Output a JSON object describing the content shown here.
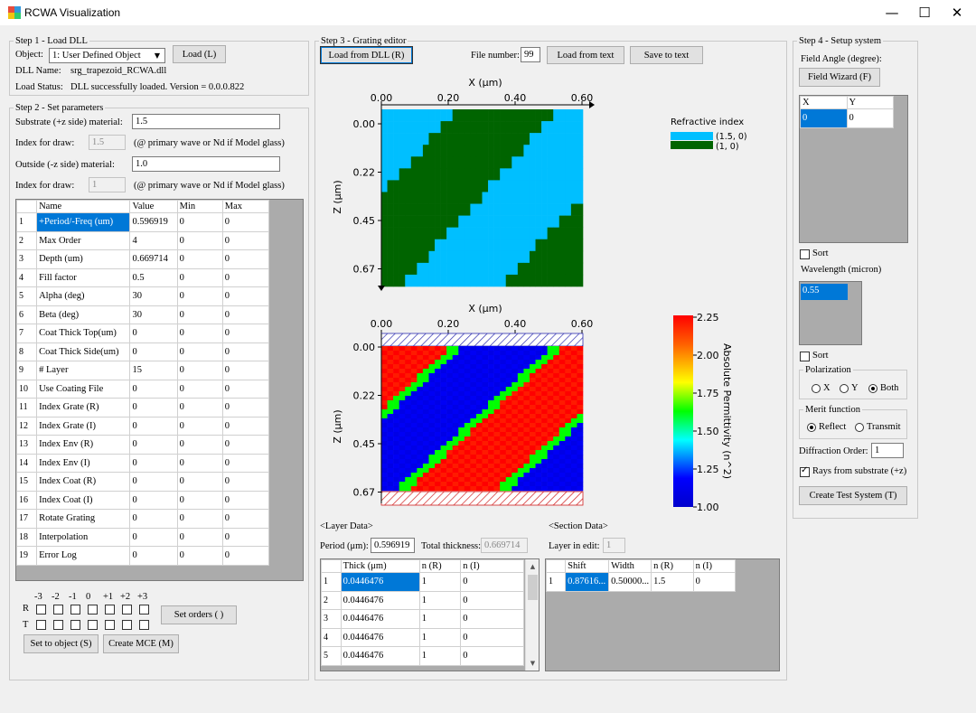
{
  "window": {
    "title": "RCWA Visualization",
    "minimize": "—",
    "maximize": "☐",
    "close": "✕"
  },
  "step1": {
    "legend": "Step 1 - Load DLL",
    "object_label": "Object:",
    "object_value": "1: User Defined Object",
    "load_button": "Load (L)",
    "dll_name_label": "DLL Name:",
    "dll_name_value": "srg_trapezoid_RCWA.dll",
    "load_status_label": "Load Status:",
    "load_status_value": "DLL successfully loaded. Version = 0.0.0.822"
  },
  "step2": {
    "legend": "Step 2 - Set parameters",
    "substrate_label": "Substrate (+z side) material:",
    "substrate_value": "1.5",
    "index_draw_label": "Index for draw:",
    "index_draw1_value": "1.5",
    "index_draw_note": "(@ primary wave or Nd if Model glass)",
    "outside_label": "Outside (-z side) material:",
    "outside_value": "1.0",
    "index_draw2_value": "1",
    "columns": [
      "Name",
      "Value",
      "Min",
      "Max"
    ],
    "rows": [
      [
        "1",
        "+Period/-Freq (um)",
        "0.596919",
        "0",
        "0"
      ],
      [
        "2",
        "Max Order",
        "4",
        "0",
        "0"
      ],
      [
        "3",
        "Depth (um)",
        "0.669714",
        "0",
        "0"
      ],
      [
        "4",
        "Fill factor",
        "0.5",
        "0",
        "0"
      ],
      [
        "5",
        "Alpha (deg)",
        "30",
        "0",
        "0"
      ],
      [
        "6",
        "Beta (deg)",
        "30",
        "0",
        "0"
      ],
      [
        "7",
        "Coat Thick Top(um)",
        "0",
        "0",
        "0"
      ],
      [
        "8",
        "Coat Thick Side(um)",
        "0",
        "0",
        "0"
      ],
      [
        "9",
        "# Layer",
        "15",
        "0",
        "0"
      ],
      [
        "10",
        "Use Coating File",
        "0",
        "0",
        "0"
      ],
      [
        "11",
        "Index Grate (R)",
        "0",
        "0",
        "0"
      ],
      [
        "12",
        "Index Grate (I)",
        "0",
        "0",
        "0"
      ],
      [
        "13",
        "Index Env (R)",
        "0",
        "0",
        "0"
      ],
      [
        "14",
        "Index Env (I)",
        "0",
        "0",
        "0"
      ],
      [
        "15",
        "Index Coat (R)",
        "0",
        "0",
        "0"
      ],
      [
        "16",
        "Index Coat (I)",
        "0",
        "0",
        "0"
      ],
      [
        "17",
        "Rotate Grating",
        "0",
        "0",
        "0"
      ],
      [
        "18",
        "Interpolation",
        "0",
        "0",
        "0"
      ],
      [
        "19",
        "Error Log",
        "0",
        "0",
        "0"
      ]
    ],
    "order_labels": [
      "-3",
      "-2",
      "-1",
      "0",
      "+1",
      "+2",
      "+3"
    ],
    "r_label": "R",
    "t_label": "T",
    "set_orders_button": "Set orders ( )",
    "set_to_object_button": "Set to object (S)",
    "create_mce_button": "Create MCE (M)"
  },
  "step3": {
    "legend": "Step 3 - Grating editor",
    "load_from_dll_button": "Load from DLL (R)",
    "file_number_label": "File number:",
    "file_number_value": "99",
    "load_from_text_button": "Load from text",
    "save_to_text_button": "Save to text",
    "plot1": {
      "xlabel": "X (μm)",
      "ylabel": "Z (μm)",
      "xticks": [
        "0.00",
        "0.20",
        "0.40",
        "0.60"
      ],
      "yticks": [
        "0.00",
        "0.22",
        "0.45",
        "0.67"
      ],
      "legend_title": "Refractive index",
      "legend_entries": [
        {
          "label": "(1.5, 0)",
          "color": "#00bfff"
        },
        {
          "label": "(1, 0)",
          "color": "#006400"
        }
      ]
    },
    "plot2": {
      "xlabel": "X (μm)",
      "ylabel": "Z (μm)",
      "xticks": [
        "0.00",
        "0.20",
        "0.40",
        "0.60"
      ],
      "yticks": [
        "0.00",
        "0.22",
        "0.45",
        "0.67"
      ],
      "colorbar_label": "Absolute Permittivity (n^2)",
      "colorbar_ticks": [
        "2.25",
        "2.00",
        "1.75",
        "1.50",
        "1.25",
        "1.00"
      ]
    },
    "layer_data_label": "<Layer Data>",
    "period_label": "Period (μm):",
    "period_value": "0.596919",
    "total_thickness_label": "Total thickness:",
    "total_thickness_value": "0.669714",
    "layer_columns": [
      "Thick (μm)",
      "n (R)",
      "n (I)"
    ],
    "layer_rows": [
      [
        "1",
        "0.0446476",
        "1",
        "0"
      ],
      [
        "2",
        "0.0446476",
        "1",
        "0"
      ],
      [
        "3",
        "0.0446476",
        "1",
        "0"
      ],
      [
        "4",
        "0.0446476",
        "1",
        "0"
      ],
      [
        "5",
        "0.0446476",
        "1",
        "0"
      ]
    ],
    "section_data_label": "<Section Data>",
    "layer_in_edit_label": "Layer in edit:",
    "layer_in_edit_value": "1",
    "section_columns": [
      "Shift",
      "Width",
      "n (R)",
      "n (I)"
    ],
    "section_rows": [
      [
        "1",
        "0.87616...",
        "0.50000...",
        "1.5",
        "0"
      ]
    ]
  },
  "step4": {
    "legend": "Step 4 - Setup system",
    "field_angle_label": "Field Angle (degree):",
    "field_wizard_button": "Field Wizard (F)",
    "field_columns": [
      "X",
      "Y"
    ],
    "field_rows": [
      [
        "0",
        "0"
      ]
    ],
    "sort_label": "Sort",
    "wavelength_label": "Wavelength (micron)",
    "wavelength_value": "0.55",
    "sort2_label": "Sort",
    "polarization_legend": "Polarization",
    "pol_x": "X",
    "pol_y": "Y",
    "pol_both": "Both",
    "merit_legend": "Merit function",
    "merit_reflect": "Reflect",
    "merit_transmit": "Transmit",
    "diffraction_order_label": "Diffraction Order:",
    "diffraction_order_value": "1",
    "rays_from_substrate_label": "Rays from substrate (+z)",
    "create_test_button": "Create Test System (T)"
  },
  "colors": {
    "selection": "#0078d7",
    "substrate": "#00bfff",
    "air": "#006400",
    "grid_bg": "#ababab"
  }
}
